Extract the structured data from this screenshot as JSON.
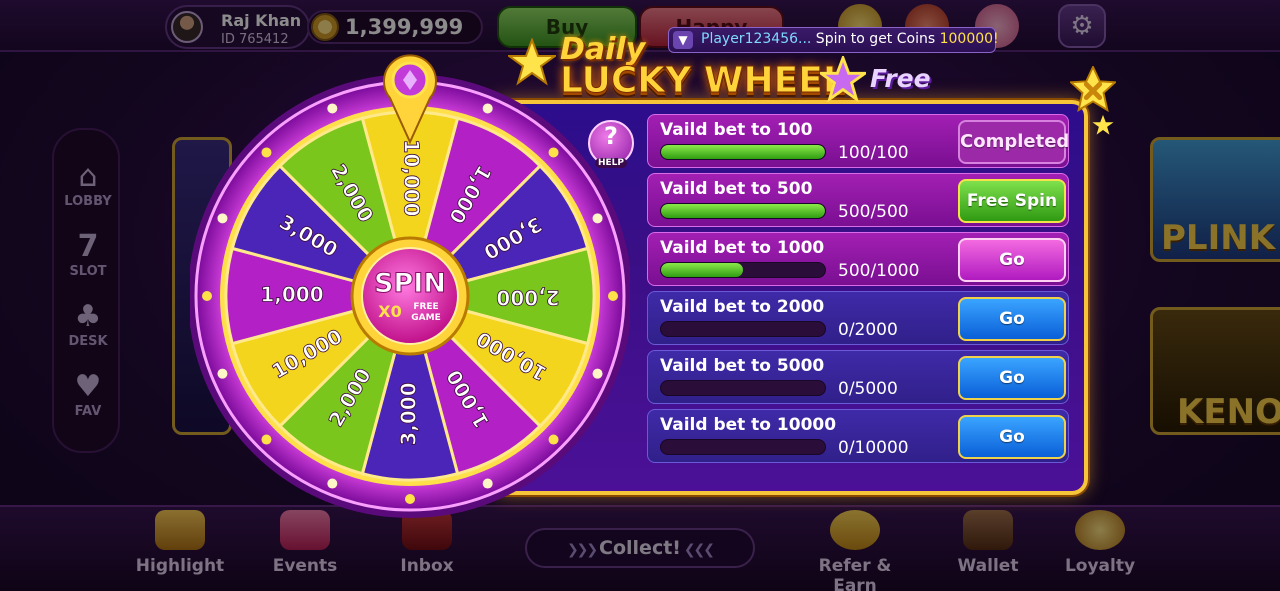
{
  "header": {
    "player_name": "Raj Khan",
    "player_id": "ID 765412",
    "coin_balance": "1,399,999",
    "buy_label": "Buy",
    "happy_label": "Happy"
  },
  "notice": {
    "player": "Player123456...",
    "message": " Spin to get Coins ",
    "amount": "100000!"
  },
  "title": {
    "daily": "Daily",
    "main": "LUCKY WHEEL",
    "free": "Free"
  },
  "help_label": "HELP",
  "wheel": {
    "center_label": "SPIN",
    "multiplier": "X0",
    "sub_label_1": "FREE",
    "sub_label_2": "GAME",
    "segments": [
      {
        "value": "10,000",
        "color": "#f3d51e"
      },
      {
        "value": "1,000",
        "color": "#b220c6"
      },
      {
        "value": "3,000",
        "color": "#4a25b8"
      },
      {
        "value": "2,000",
        "color": "#7ac61c"
      },
      {
        "value": "10,000",
        "color": "#f3d51e"
      },
      {
        "value": "1,000",
        "color": "#b220c6"
      },
      {
        "value": "3,000",
        "color": "#4a25b8"
      },
      {
        "value": "2,000",
        "color": "#7ac61c"
      },
      {
        "value": "10,000",
        "color": "#f3d51e"
      },
      {
        "value": "1,000",
        "color": "#b220c6"
      },
      {
        "value": "3,000",
        "color": "#4a25b8"
      },
      {
        "value": "2,000",
        "color": "#7ac61c"
      }
    ]
  },
  "tasks": [
    {
      "label": "Vaild bet to 100",
      "progress_text": "100/100",
      "progress": 1.0,
      "button": "Completed",
      "style": "pink",
      "button_type": "completed"
    },
    {
      "label": "Vaild bet to 500",
      "progress_text": "500/500",
      "progress": 1.0,
      "button": "Free Spin",
      "style": "pink",
      "button_type": "free"
    },
    {
      "label": "Vaild bet to 1000",
      "progress_text": "500/1000",
      "progress": 0.5,
      "button": "Go",
      "style": "pink",
      "button_type": "gopink"
    },
    {
      "label": "Vaild bet to 2000",
      "progress_text": "0/2000",
      "progress": 0.0,
      "button": "Go",
      "style": "blue",
      "button_type": "goblue"
    },
    {
      "label": "Vaild bet to 5000",
      "progress_text": "0/5000",
      "progress": 0.0,
      "button": "Go",
      "style": "blue",
      "button_type": "goblue"
    },
    {
      "label": "Vaild bet to 10000",
      "progress_text": "0/10000",
      "progress": 0.0,
      "button": "Go",
      "style": "blue",
      "button_type": "goblue"
    }
  ],
  "sidenav": [
    {
      "label": "LOBBY",
      "icon": "house-icon"
    },
    {
      "label": "SLOT",
      "icon": "seven-icon"
    },
    {
      "label": "DESK",
      "icon": "cards-icon"
    },
    {
      "label": "FAV",
      "icon": "heart-icon"
    }
  ],
  "tiles": [
    {
      "label": "PLINK"
    },
    {
      "label": "KENO"
    }
  ],
  "bottom_nav": [
    {
      "label": "Highlight",
      "icon": "clapper-icon"
    },
    {
      "label": "Events",
      "icon": "hot-star-icon"
    },
    {
      "label": "Inbox",
      "icon": "mail-icon"
    },
    {
      "label": "Refer & Earn",
      "icon": "coin-bag-icon"
    },
    {
      "label": "Wallet",
      "icon": "wallet-icon"
    },
    {
      "label": "Loyalty",
      "icon": "crown-badge-icon"
    }
  ],
  "collect_label": "Collect!",
  "colors": {
    "gold": "#f7c53a",
    "panel": "#3a0f86",
    "progress_green": "#2f9d12"
  }
}
